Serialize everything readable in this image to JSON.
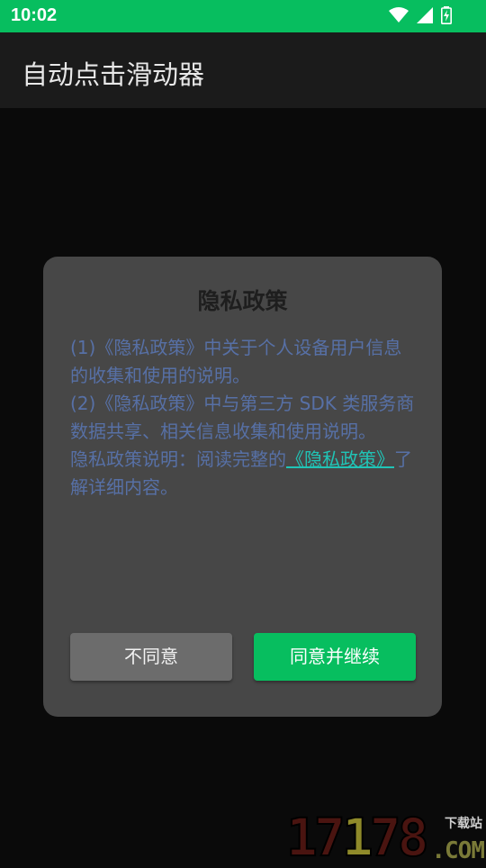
{
  "status_bar": {
    "time": "10:02",
    "icons": [
      "wifi-icon",
      "cellular-signal-icon",
      "battery-charging-icon"
    ],
    "background": "#07be5f"
  },
  "app_bar": {
    "title": "自动点击滑动器"
  },
  "dialog": {
    "title": "隐私政策",
    "line1": "(1)《隐私政策》中关于个人设备用户信息的收集和使用的说明。",
    "line2": "(2)《隐私政策》中与第三方 SDK 类服务商数据共享、相关信息收集和使用说明。",
    "line3_prefix": "隐私政策说明：阅读完整的",
    "line3_link": "《隐私政策》",
    "line3_suffix": "了解详细内容。",
    "decline_label": "不同意",
    "agree_label": "同意并继续",
    "agree_color": "#07be5f",
    "link_color": "#20c4b6"
  },
  "watermark": {
    "digits_a": "17",
    "digits_b": "1",
    "digits_c": "78",
    "site": "下载站",
    "com": ".COM"
  }
}
